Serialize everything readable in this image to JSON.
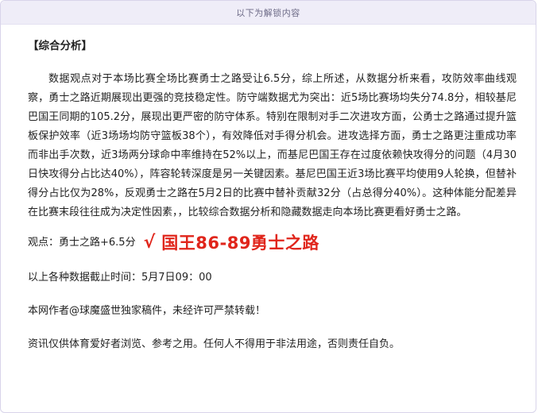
{
  "banner": {
    "text": "以下为解锁内容"
  },
  "article": {
    "section_title": "【综合分析】",
    "body": "数据观点对于本场比赛全场比赛勇士之路受让6.5分，综上所述，从数据分析来看，攻防效率曲线观察，勇士之路近期展现出更强的竞技稳定性。防守端数据尤为突出：近5场比赛场均失分74.8分，相较基尼巴国王同期的105.2分，展现出更严密的防守体系。特别在限制对手二次进攻方面，公勇士之路通过提升篮板保护效率（近3场场均防守篮板38个），有效降低对手得分机会。进攻选择方面，勇士之路更注重成功率而非出手次数，近3场两分球命中率维持在52%以上，而基尼巴国王存在过度依赖快攻得分的问题（4月30日快攻得分占比达40%），阵容轮转深度是另一关键因素。基尼巴国王近3场比赛平均使用9人轮换，但替补得分占比仅为28%，反观勇士之路在5月2日的比赛中替补贡献32分（占总得分40%）。这种体能分配差异在比赛末段往往成为决定性因素，，比较综合数据分析和隐藏数据走向本场比赛更看好勇士之路。",
    "viewpoint_label": "观点：勇士之路+6.5分",
    "viewpoint_check": "√",
    "viewpoint_result": "国王86-89勇士之路",
    "cutoff": "以上各种数据截止时间：5月7日09：00",
    "copyright": "本网作者@球魔盛世独家稿件，未经许可严禁转载！",
    "disclaimer": "资讯仅供体育爱好者浏览、参考之用。任何人不得用于非法用途，否则责任自负。"
  },
  "colors": {
    "accent_red": "#e0251b",
    "banner_bg": "#efedf8",
    "banner_text": "#6c6a86"
  }
}
